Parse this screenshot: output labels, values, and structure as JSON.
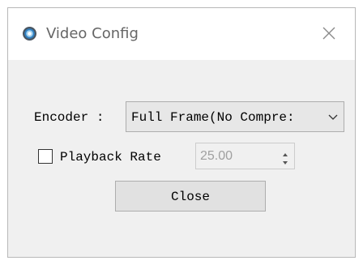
{
  "window": {
    "title": "Video Config",
    "close_icon": "close-icon",
    "app_icon": "app-globe-icon"
  },
  "encoder": {
    "label": "Encoder :",
    "selected": "Full Frame(No Compre:"
  },
  "playback": {
    "checked": false,
    "label": "Playback Rate",
    "value": "25.00",
    "enabled": false
  },
  "actions": {
    "close_label": "Close"
  }
}
